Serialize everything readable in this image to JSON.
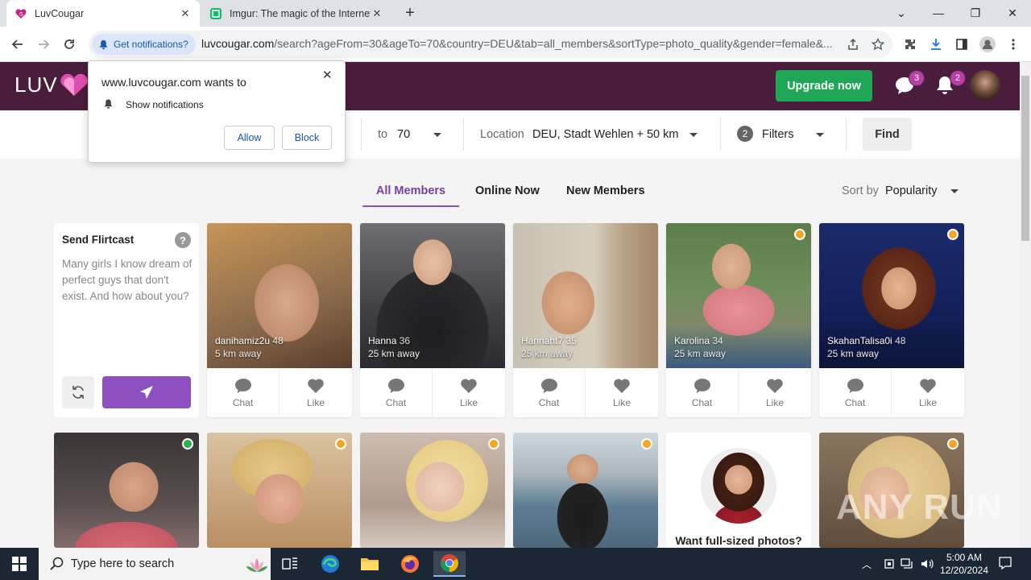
{
  "browser": {
    "tabs": [
      {
        "title": "LuvCougar",
        "active": true
      },
      {
        "title": "Imgur: The magic of the Internet",
        "active": false
      }
    ],
    "notification_chip": "Get notifications?",
    "url_host": "luvcougar.com",
    "url_path": "/search?ageFrom=30&ageTo=70&country=DEU&tab=all_members&sortType=photo_quality&gender=female&..."
  },
  "popup": {
    "title": "www.luvcougar.com wants to",
    "permission": "Show notifications",
    "allow_label": "Allow",
    "block_label": "Block"
  },
  "site": {
    "logo": "LUV",
    "upgrade_label": "Upgrade now",
    "messages_count": "3",
    "notifications_count": "2"
  },
  "search": {
    "to_label": "to",
    "age_to": "70",
    "location_label": "Location",
    "location_value": "DEU, Stadt Wehlen + 50 km",
    "filter_count": "2",
    "filters_label": "Filters",
    "find_label": "Find"
  },
  "member_tabs": [
    "All Members",
    "Online Now",
    "New Members"
  ],
  "sort": {
    "label": "Sort by",
    "value": "Popularity"
  },
  "flirtcast": {
    "title": "Send Flirtcast",
    "help": "?",
    "text": "Many girls I know dream of perfect guys that don't exist. And how about you?"
  },
  "actions": {
    "chat": "Chat",
    "like": "Like"
  },
  "members_row1": [
    {
      "name": "danihamiz2u",
      "age": "48",
      "distance": "5 km away",
      "online": ""
    },
    {
      "name": "Hanna",
      "age": "36",
      "distance": "25 km away",
      "online": ""
    },
    {
      "name": "Hannaht7",
      "age": "35",
      "distance": "25 km away",
      "online": ""
    },
    {
      "name": "Karolina",
      "age": "34",
      "distance": "25 km away",
      "online": "orange"
    },
    {
      "name": "SkahanTalisa0i",
      "age": "48",
      "distance": "25 km away",
      "online": "orange"
    }
  ],
  "promo": {
    "text": "Want full-sized photos?"
  },
  "taskbar": {
    "search_placeholder": "Type here to search",
    "time": "5:00 AM",
    "date": "12/20/2024"
  },
  "watermark": "ANY RUN"
}
